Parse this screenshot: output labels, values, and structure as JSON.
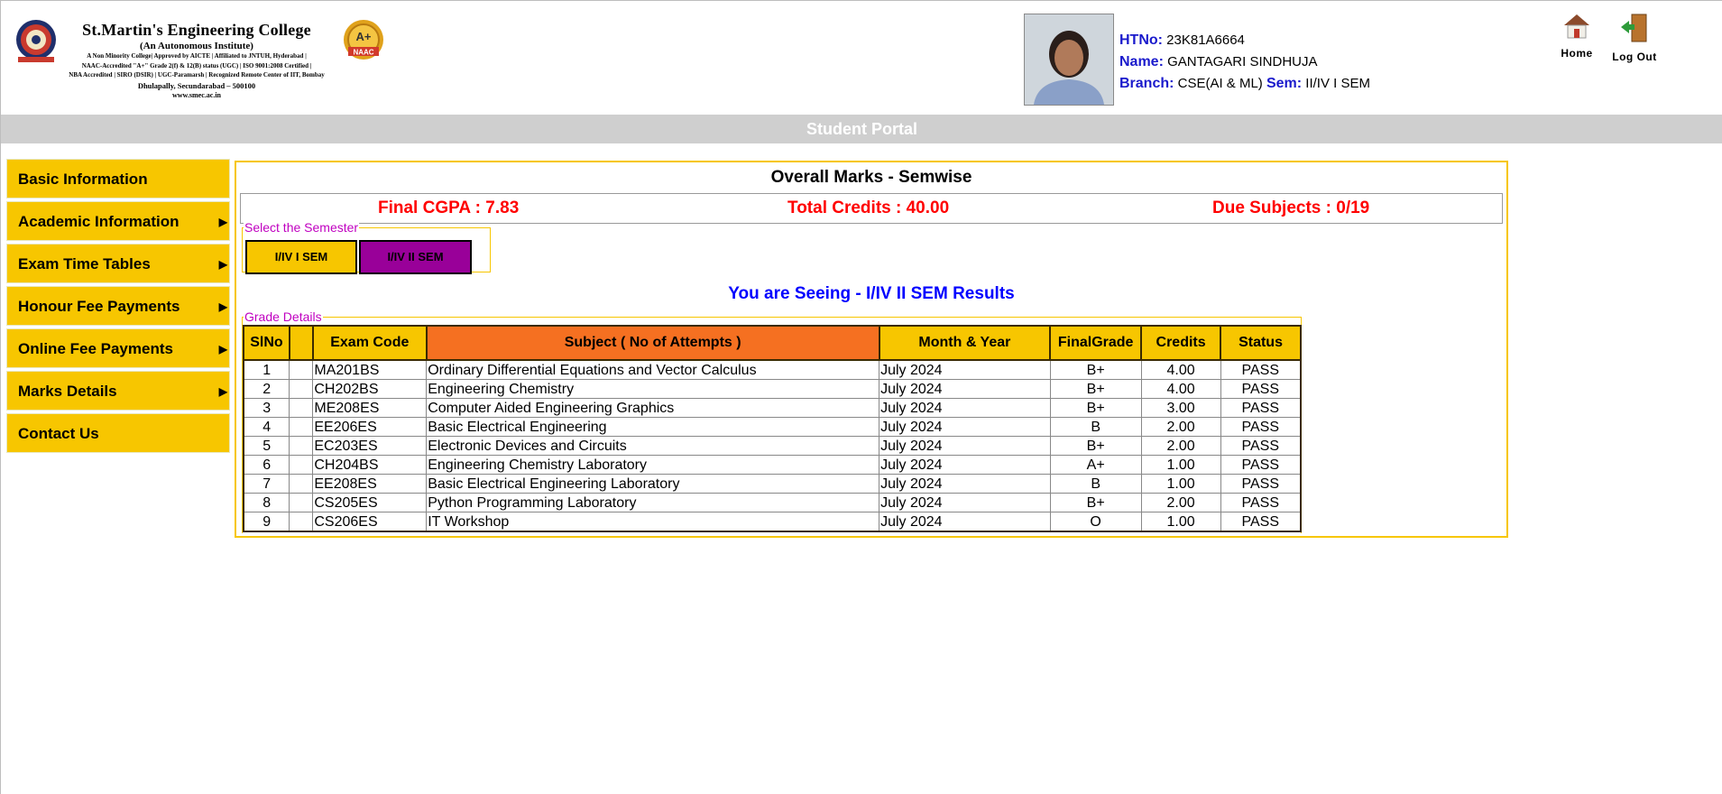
{
  "header": {
    "college_name": "St.Martin's Engineering College",
    "college_sub": "(An Autonomous Institute)",
    "college_lines": [
      "A Non Minority College| Approved by AICTE | Affiliated to JNTUH, Hyderabad |",
      "NAAC-Accredited \"A+\" Grade 2(f) & 12(B) status (UGC) | ISO 9001:2008 Certified |",
      "NBA Accredited | SIRO (DSIR) | UGC-Paramarsh | Recognized Remote Center of IIT, Bombay"
    ],
    "college_address": "Dhulapally, Secundarabad – 500100",
    "college_web": "www.smec.ac.in",
    "naac_badge": "A+",
    "naac_text": "NAAC",
    "student": {
      "htno_label": "HTNo:",
      "htno": "23K81A6664",
      "name_label": "Name:",
      "name": "GANTAGARI SINDHUJA",
      "branch_label": "Branch:",
      "branch": "CSE(AI & ML)",
      "sem_label": "Sem:",
      "sem": "II/IV I SEM"
    },
    "home_label": "Home",
    "logout_label": "Log Out"
  },
  "portal_title": "Student Portal",
  "sidebar": {
    "items": [
      {
        "label": "Basic Information",
        "arrow": false
      },
      {
        "label": "Academic Information",
        "arrow": true
      },
      {
        "label": "Exam Time Tables",
        "arrow": true
      },
      {
        "label": "Honour Fee Payments",
        "arrow": true
      },
      {
        "label": "Online Fee Payments",
        "arrow": true
      },
      {
        "label": "Marks Details",
        "arrow": true
      },
      {
        "label": "Contact Us",
        "arrow": false
      }
    ],
    "arrow_glyph": "▶"
  },
  "main": {
    "title": "Overall Marks - Semwise",
    "cgpa": "Final CGPA : 7.83",
    "credits": "Total Credits : 40.00",
    "due": "Due Subjects : 0/19",
    "semester_legend": "Select the Semester",
    "sem_buttons": [
      "I/IV I SEM",
      "I/IV II SEM"
    ],
    "seeing": "You are Seeing - I/IV II SEM Results",
    "grade_legend": "Grade Details",
    "columns": [
      "SlNo",
      "",
      "Exam Code",
      "Subject ( No of Attempts )",
      "Month & Year",
      "FinalGrade",
      "Credits",
      "Status"
    ],
    "rows": [
      [
        "1",
        "",
        "MA201BS",
        "Ordinary Differential Equations and Vector Calculus",
        "July 2024",
        "B+",
        "4.00",
        "PASS"
      ],
      [
        "2",
        "",
        "CH202BS",
        "Engineering Chemistry",
        "July 2024",
        "B+",
        "4.00",
        "PASS"
      ],
      [
        "3",
        "",
        "ME208ES",
        "Computer Aided Engineering Graphics",
        "July 2024",
        "B+",
        "3.00",
        "PASS"
      ],
      [
        "4",
        "",
        "EE206ES",
        "Basic Electrical Engineering",
        "July 2024",
        "B",
        "2.00",
        "PASS"
      ],
      [
        "5",
        "",
        "EC203ES",
        "Electronic Devices and Circuits",
        "July 2024",
        "B+",
        "2.00",
        "PASS"
      ],
      [
        "6",
        "",
        "CH204BS",
        "Engineering Chemistry Laboratory",
        "July 2024",
        "A+",
        "1.00",
        "PASS"
      ],
      [
        "7",
        "",
        "EE208ES",
        "Basic Electrical Engineering Laboratory",
        "July 2024",
        "B",
        "1.00",
        "PASS"
      ],
      [
        "8",
        "",
        "CS205ES",
        "Python Programming Laboratory",
        "July 2024",
        "B+",
        "2.00",
        "PASS"
      ],
      [
        "9",
        "",
        "CS206ES",
        "IT Workshop",
        "July 2024",
        "O",
        "1.00",
        "PASS"
      ]
    ]
  },
  "colors": {
    "menu_yellow": "#f7c600",
    "header_orange": "#f57021",
    "summary_red": "#ff0000",
    "seeing_blue": "#0000ff",
    "sem2_purple": "#990099",
    "legend_magenta": "#c000c0"
  },
  "icons": {
    "home": "house-icon",
    "logout": "door-exit-icon"
  }
}
